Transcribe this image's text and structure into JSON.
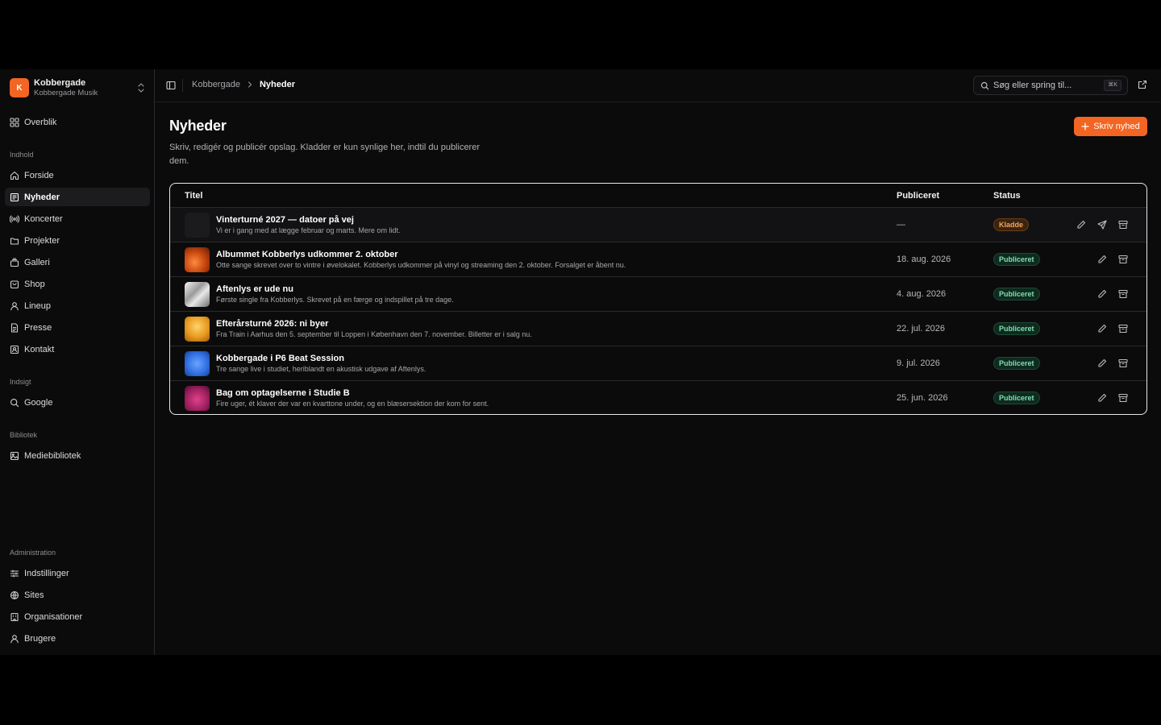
{
  "org": {
    "logo_letter": "K",
    "name": "Kobbergade",
    "subtitle": "Kobbergade Musik"
  },
  "sidebar": {
    "overview": "Overblik",
    "groups": [
      {
        "label": "Indhold",
        "items": [
          "Forside",
          "Nyheder",
          "Koncerter",
          "Projekter",
          "Galleri",
          "Shop",
          "Lineup",
          "Presse",
          "Kontakt"
        ]
      },
      {
        "label": "Indsigt",
        "items": [
          "Google"
        ]
      },
      {
        "label": "Bibliotek",
        "items": [
          "Mediebibliotek"
        ]
      },
      {
        "label": "Administration",
        "items": [
          "Indstillinger",
          "Sites",
          "Organisationer",
          "Brugere"
        ]
      }
    ],
    "active_item": "Nyheder"
  },
  "topbar": {
    "breadcrumb": [
      "Kobbergade",
      "Nyheder"
    ],
    "search_placeholder": "Søg eller spring til...",
    "search_shortcut": "⌘K"
  },
  "page": {
    "title": "Nyheder",
    "description": "Skriv, redigér og publicér opslag. Kladder er kun synlige her, indtil du publicerer dem.",
    "new_button": "Skriv nyhed"
  },
  "table": {
    "columns": {
      "title": "Titel",
      "published": "Publiceret",
      "status": "Status"
    },
    "rows": [
      {
        "title": "Vinterturné 2027 — datoer på vej",
        "excerpt": "Vi er i gang med at lægge februar og marts. Mere om lidt.",
        "date": "—",
        "status": "Kladde",
        "kind": "draft",
        "thumb": "none"
      },
      {
        "title": "Albummet Kobberlys udkommer 2. oktober",
        "excerpt": "Otte sange skrevet over to vintre i øvelokalet. Kobberlys udkommer på vinyl og streaming den 2. oktober. Forsalget er åbent nu.",
        "date": "18. aug. 2026",
        "status": "Publiceret",
        "kind": "published",
        "thumb": "orange"
      },
      {
        "title": "Aftenlys er ude nu",
        "excerpt": "Første single fra Kobberlys. Skrevet på en færge og indspillet på tre dage.",
        "date": "4. aug. 2026",
        "status": "Publiceret",
        "kind": "published",
        "thumb": "silver"
      },
      {
        "title": "Efterårsturné 2026: ni byer",
        "excerpt": "Fra Train i Aarhus den 5. september til Loppen i København den 7. november. Billetter er i salg nu.",
        "date": "22. jul. 2026",
        "status": "Publiceret",
        "kind": "published",
        "thumb": "gold"
      },
      {
        "title": "Kobbergade i P6 Beat Session",
        "excerpt": "Tre sange live i studiet, heriblandt en akustisk udgave af Aftenlys.",
        "date": "9. jul. 2026",
        "status": "Publiceret",
        "kind": "published",
        "thumb": "blue"
      },
      {
        "title": "Bag om optagelserne i Studie B",
        "excerpt": "Fire uger, ét klaver der var en kvarttone under, og en blæsersektion der kom for sent.",
        "date": "25. jun. 2026",
        "status": "Publiceret",
        "kind": "published",
        "thumb": "magenta"
      }
    ]
  },
  "colors": {
    "accent": "#f26522",
    "draft_badge": "#f5a55a",
    "published_badge": "#7ee0b0"
  }
}
